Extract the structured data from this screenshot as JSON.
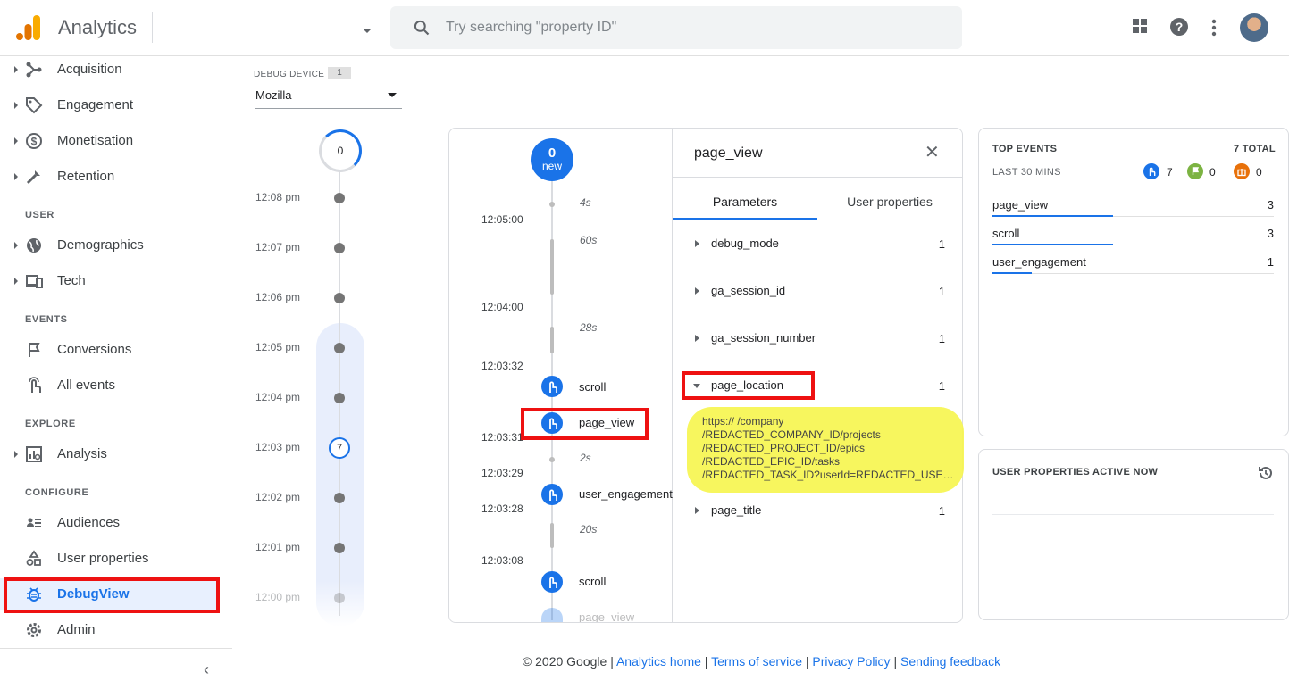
{
  "header": {
    "app_title": "Analytics",
    "search_placeholder": "Try searching \"property ID\""
  },
  "sidebar": {
    "items": [
      {
        "label": "Acquisition",
        "icon": "acquisition-icon"
      },
      {
        "label": "Engagement",
        "icon": "tag-icon"
      },
      {
        "label": "Monetisation",
        "icon": "dollar-icon"
      },
      {
        "label": "Retention",
        "icon": "retention-icon"
      },
      {
        "label": "Demographics",
        "icon": "globe-icon"
      },
      {
        "label": "Tech",
        "icon": "devices-icon"
      },
      {
        "label": "Conversions",
        "icon": "flag-icon"
      },
      {
        "label": "All events",
        "icon": "touch-icon"
      },
      {
        "label": "Analysis",
        "icon": "analysis-icon"
      },
      {
        "label": "Audiences",
        "icon": "audiences-icon"
      },
      {
        "label": "User properties",
        "icon": "user-properties-icon"
      },
      {
        "label": "DebugView",
        "icon": "bug-icon"
      },
      {
        "label": "Admin",
        "icon": "gear-icon"
      }
    ],
    "sections": {
      "user": "USER",
      "events": "EVENTS",
      "explore": "EXPLORE",
      "configure": "CONFIGURE"
    },
    "collapse_glyph": "‹"
  },
  "device": {
    "label": "DEBUG DEVICE",
    "count": "1",
    "selected": "Mozilla"
  },
  "minutes": {
    "top_count": "0",
    "rows": [
      "12:08 pm",
      "12:07 pm",
      "12:06 pm",
      "12:05 pm",
      "12:04 pm",
      "12:03 pm",
      "12:02 pm",
      "12:01 pm",
      "12:00 pm"
    ],
    "selected_count": "7"
  },
  "seconds": {
    "bubble_count": "0",
    "bubble_label": "new",
    "gaps": [
      "4s",
      "60s",
      "28s",
      "2s",
      "20s"
    ],
    "times": [
      "12:05:00",
      "12:04:00",
      "12:03:32",
      "12:03:31",
      "12:03:29",
      "12:03:28",
      "12:03:08"
    ],
    "events": [
      "scroll",
      "page_view",
      "user_engagement",
      "scroll",
      "page_view"
    ]
  },
  "detail": {
    "title": "page_view",
    "close_glyph": "✕",
    "tabs": [
      "Parameters",
      "User properties"
    ],
    "params": [
      {
        "name": "debug_mode",
        "value": "1"
      },
      {
        "name": "ga_session_id",
        "value": "1"
      },
      {
        "name": "ga_session_number",
        "value": "1"
      },
      {
        "name": "page_location",
        "value": "1"
      },
      {
        "name": "page_title",
        "value": "1"
      }
    ],
    "url_lines": [
      "https://                         /company",
      "/REDACTED_COMPANY_ID/projects",
      "/REDACTED_PROJECT_ID/epics",
      "/REDACTED_EPIC_ID/tasks",
      "/REDACTED_TASK_ID?userId=REDACTED_USER_..."
    ]
  },
  "top_events": {
    "title": "TOP EVENTS",
    "total": "7 TOTAL",
    "period": "LAST 30 MINS",
    "legend": [
      {
        "count": "7",
        "color": "#1a73e8",
        "icon": "touch-icon"
      },
      {
        "count": "0",
        "color": "#7cb342",
        "icon": "flag-icon"
      },
      {
        "count": "0",
        "color": "#e8710a",
        "icon": "gift-icon"
      }
    ],
    "rows": [
      {
        "name": "page_view",
        "count": "3",
        "share": 0.43
      },
      {
        "name": "scroll",
        "count": "3",
        "share": 0.43
      },
      {
        "name": "user_engagement",
        "count": "1",
        "share": 0.14
      }
    ]
  },
  "user_properties": {
    "title": "USER PROPERTIES ACTIVE NOW"
  },
  "footer": {
    "copyright": "© 2020 Google",
    "links": [
      "Analytics home",
      "Terms of service",
      "Privacy Policy",
      "Sending feedback"
    ],
    "separator": " | "
  }
}
